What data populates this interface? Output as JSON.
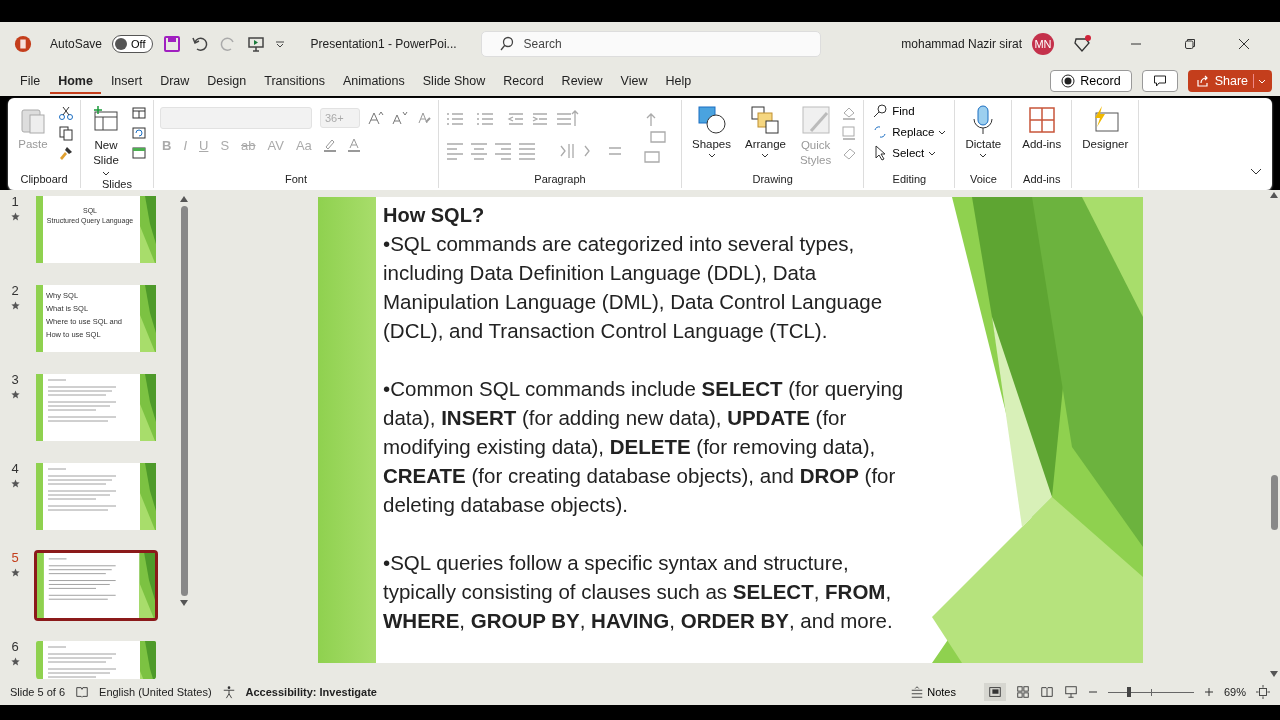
{
  "titlebar": {
    "autosave_label": "AutoSave",
    "autosave": {
      "label": "Off",
      "on": false
    },
    "document_title": "Presentation1  -  PowerPoi...",
    "search": {
      "placeholder": "Search"
    },
    "user_name": "mohammad Nazir sirat",
    "avatar_initials": "MN"
  },
  "tabs": [
    {
      "label": "File",
      "selected": false
    },
    {
      "label": "Home",
      "selected": true
    },
    {
      "label": "Insert",
      "selected": false
    },
    {
      "label": "Draw",
      "selected": false
    },
    {
      "label": "Design",
      "selected": false
    },
    {
      "label": "Transitions",
      "selected": false
    },
    {
      "label": "Animations",
      "selected": false
    },
    {
      "label": "Slide Show",
      "selected": false
    },
    {
      "label": "Record",
      "selected": false
    },
    {
      "label": "Review",
      "selected": false
    },
    {
      "label": "View",
      "selected": false
    },
    {
      "label": "Help",
      "selected": false
    }
  ],
  "record_button": "Record",
  "share_button": "Share",
  "ribbon": {
    "clipboard": {
      "label": "Clipboard",
      "paste": {
        "label": "Paste",
        "disabled": true
      }
    },
    "slides": {
      "label": "Slides",
      "new_slide": [
        "New",
        "Slide"
      ]
    },
    "font": {
      "label": "Font",
      "size": "36+",
      "disabled": true,
      "buttons": [
        "B",
        "I",
        "U",
        "S",
        "ab",
        "AV",
        "Aa"
      ]
    },
    "paragraph": {
      "label": "Paragraph",
      "disabled": true
    },
    "drawing": {
      "label": "Drawing",
      "shapes": "Shapes",
      "arrange": "Arrange",
      "quick_styles": {
        "label": [
          "Quick",
          "Styles"
        ],
        "disabled": true
      }
    },
    "editing": {
      "label": "Editing",
      "find": "Find",
      "replace": "Replace",
      "select": "Select"
    },
    "voice": {
      "label": "Voice",
      "dictate": "Dictate"
    },
    "addins": {
      "label": "Add-ins",
      "button": "Add-ins"
    },
    "designer": "Designer"
  },
  "slides": [
    {
      "number": "1",
      "selected": false,
      "lines": [
        "SQL",
        "Structured Query Language"
      ]
    },
    {
      "number": "2",
      "selected": false,
      "lines": [
        "Why SQL",
        "What is SQL",
        "Where to use SQL and",
        "How to use SQL"
      ]
    },
    {
      "number": "3",
      "selected": false
    },
    {
      "number": "4",
      "selected": false
    },
    {
      "number": "5",
      "selected": true
    },
    {
      "number": "6",
      "selected": false
    }
  ],
  "slide": {
    "title": "How SQL?",
    "paragraphs": [
      "•SQL commands are categorized into several types, including Data Definition Language (DDL), Data Manipulation Language (DML), Data Control Language (DCL), and Transaction Control Language (TCL).",
      "•Common SQL commands include **SELECT** (for querying data), **INSERT** (for adding new data), **UPDATE** (for modifying existing data), **DELETE** (for removing data), **CREATE** (for creating database objects), and **DROP** (for deleting database objects).",
      "•SQL queries follow a specific syntax and structure, typically consisting of clauses such as **SELECT**, **FROM**, **WHERE**, **GROUP BY**, **HAVING**, **ORDER BY**, and more."
    ]
  },
  "status_bar": {
    "slide_count": "Slide 5 of 6",
    "language": "English (United States)",
    "accessibility": "Accessibility: Investigate",
    "notes": "Notes",
    "zoom": {
      "level": 0.25,
      "reading": "69%"
    }
  }
}
